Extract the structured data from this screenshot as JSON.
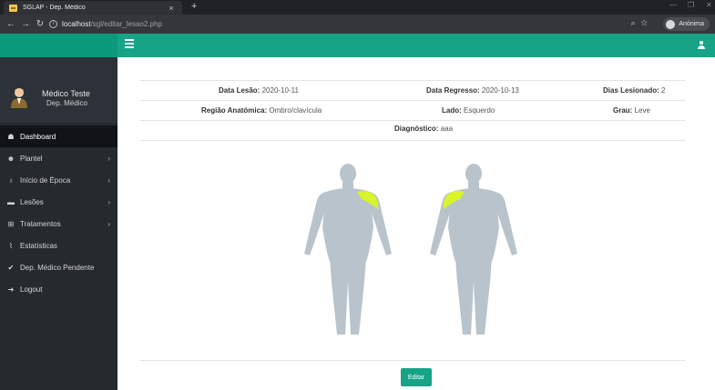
{
  "browser": {
    "tab_title": "SGLAP - Dep. Médico",
    "tab_close": "×",
    "new_tab": "+",
    "url_host": "localhost",
    "url_path": "/sgl/editar_lesao2.php",
    "profile_label": "Anónima",
    "icons": [
      "back-icon",
      "forward-icon",
      "reload-icon",
      "info-icon",
      "zoom-icon",
      "star-icon",
      "avatar-icon"
    ]
  },
  "header": {
    "menu_icon": "hamburger-icon",
    "user_icon": "user-icon",
    "accent": "#16a386"
  },
  "sidebar": {
    "user_name": "Médico Teste",
    "user_role": "Dep. Médico",
    "items": [
      {
        "label": "Dashboard",
        "icon": "dashboard-icon",
        "glyph": "☗",
        "active": true,
        "arrow": ""
      },
      {
        "label": "Plantel",
        "icon": "users-icon",
        "glyph": "☻",
        "active": false,
        "arrow": "›"
      },
      {
        "label": "Início de Época",
        "icon": "stethoscope-icon",
        "glyph": "♁",
        "active": false,
        "arrow": "›"
      },
      {
        "label": "Lesões",
        "icon": "ambulance-icon",
        "glyph": "▬",
        "active": false,
        "arrow": "›"
      },
      {
        "label": "Tratamentos",
        "icon": "medkit-icon",
        "glyph": "⊞",
        "active": false,
        "arrow": "›"
      },
      {
        "label": "Estatísticas",
        "icon": "chart-icon",
        "glyph": "⌇",
        "active": false,
        "arrow": ""
      },
      {
        "label": "Dep. Médico Pendente",
        "icon": "check-icon",
        "glyph": "✔",
        "active": false,
        "arrow": ""
      },
      {
        "label": "Logout",
        "icon": "logout-icon",
        "glyph": "➜",
        "active": false,
        "arrow": ""
      }
    ]
  },
  "injury": {
    "data_lesao_label": "Data Lesão:",
    "data_lesao": "2020-10-11",
    "data_regresso_label": "Data Regresso:",
    "data_regresso": "2020-10-13",
    "dias_label": "Dias Lesionado:",
    "dias": "2",
    "regiao_label": "Região Anatómica:",
    "regiao": "Ombro/clavícula",
    "lado_label": "Lado:",
    "lado": "Esquerdo",
    "grau_label": "Grau:",
    "grau": "Leve",
    "diagnostico_label": "Diagnóstico:",
    "diagnostico": "aaa",
    "highlight_color": "#d7f52a",
    "body_color": "#b8c3cb"
  },
  "actions": {
    "edit_label": "Editar"
  }
}
